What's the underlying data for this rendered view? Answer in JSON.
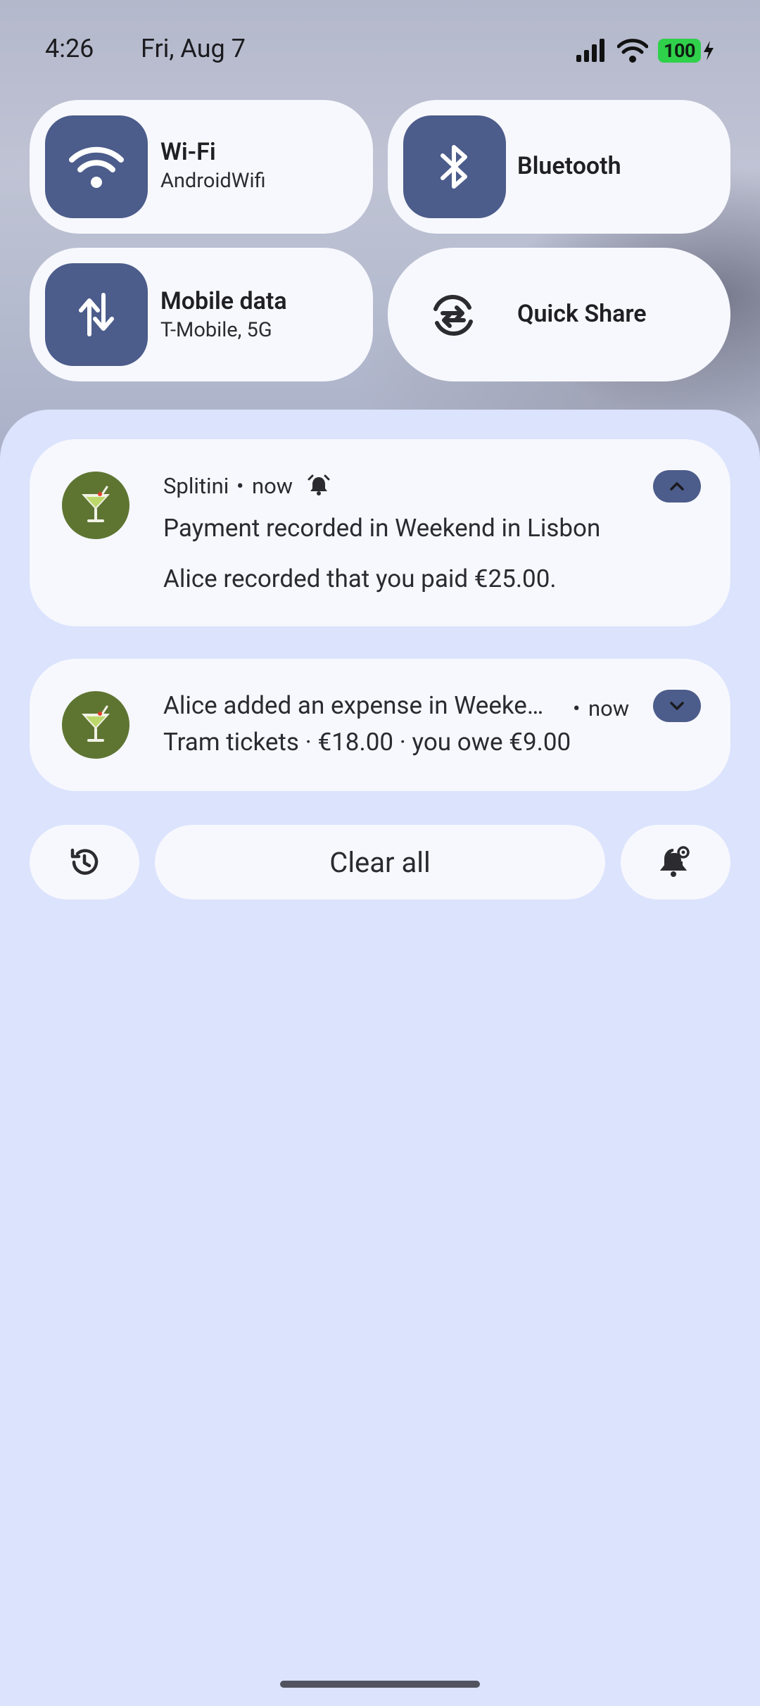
{
  "status_bar": {
    "time": "4:26",
    "date": "Fri, Aug 7",
    "battery": "100"
  },
  "tiles": {
    "wifi": {
      "title": "Wi-Fi",
      "subtitle": "AndroidWifi",
      "icon": "wifi-icon"
    },
    "bluetooth": {
      "title": "Bluetooth",
      "icon": "bluetooth-icon"
    },
    "mobile_data": {
      "title": "Mobile data",
      "subtitle": "T-Mobile, 5G",
      "icon": "mobile-data-icon"
    },
    "quick_share": {
      "title": "Quick Share",
      "icon": "quick-share-icon"
    }
  },
  "notifications": [
    {
      "app": "Splitini",
      "time": "now",
      "title": "Payment recorded in Weekend in Lisbon",
      "text": "Alice recorded that you paid €25.00.",
      "expanded": true
    },
    {
      "title": "Alice added an expense in Weeke…",
      "time": "now",
      "text": "Tram tickets · €18.00 · you owe €9.00",
      "expanded": false
    }
  ],
  "actions": {
    "clear_all": "Clear all"
  },
  "colors": {
    "tile_accent": "#4c5c8b",
    "panel_bg": "#dbe3fd",
    "card_bg": "#f7f8fd",
    "app_icon_bg": "#5e7532",
    "battery": "#2fd14b"
  }
}
